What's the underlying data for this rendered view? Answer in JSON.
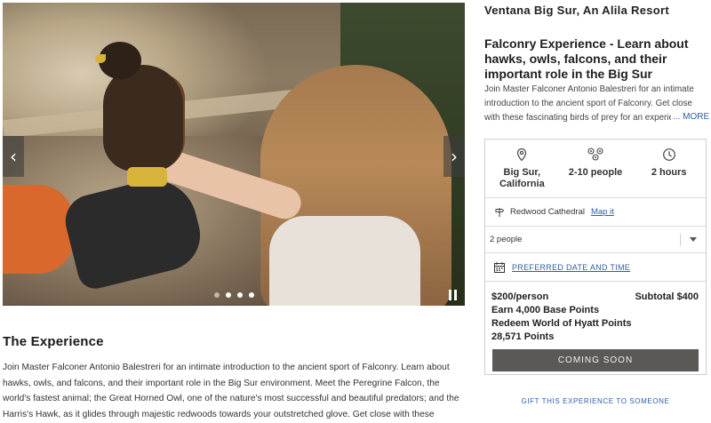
{
  "carousel": {
    "prev_icon": "‹",
    "next_icon": "›",
    "slide_count": 4,
    "active_slide": 1
  },
  "experience": {
    "heading": "The Experience",
    "body": "Join Master Falconer Antonio Balestreri for an intimate introduction to the ancient sport of Falconry. Learn about hawks, owls, and falcons, and their important role in the Big Sur environment. Meet the Peregrine Falcon, the world's fastest animal; the Great Horned Owl, one of the nature's most successful and beautiful predators; and the Harris's Hawk, as it glides through majestic redwoods towards your outstretched glove. Get close with these fascinating birds of prey for an experience you will never forget."
  },
  "resort_name": "Ventana Big Sur, An Alila Resort",
  "title": "Falconry Experience - Learn about hawks, owls, falcons, and their important role in the Big Sur",
  "summary": "Join Master Falconer Antonio Balestreri for an intimate introduction to the ancient sport of Falconry. Get close with these fascinating birds of prey for an experience you will never forget.",
  "more_label": "... MORE",
  "facts": {
    "location": "Big Sur, California",
    "group_size": "2-10 people",
    "duration": "2 hours"
  },
  "venue": {
    "name": "Redwood Cathedral",
    "map_link": "Map it"
  },
  "people_select": {
    "selected": "2 people"
  },
  "date_picker": {
    "label": "PREFERRED DATE AND TIME"
  },
  "pricing": {
    "price": "$200/person",
    "subtotal": "Subtotal $400",
    "earn_points": "Earn 4,000 Base Points",
    "redeem_label": "Redeem World of Hyatt Points",
    "redeem_points": "28,571 Points"
  },
  "cta_label": "COMING SOON",
  "gift_label": "GIFT THIS EXPERIENCE TO SOMEONE",
  "colors": {
    "link": "#2f5ea8",
    "cta_background": "#5a5955"
  },
  "icons": {
    "location": "map-pin-icon",
    "people": "group-icon",
    "duration": "clock-icon",
    "venue": "signpost-icon",
    "date": "calendar-icon",
    "dropdown": "chevron-down-icon"
  }
}
